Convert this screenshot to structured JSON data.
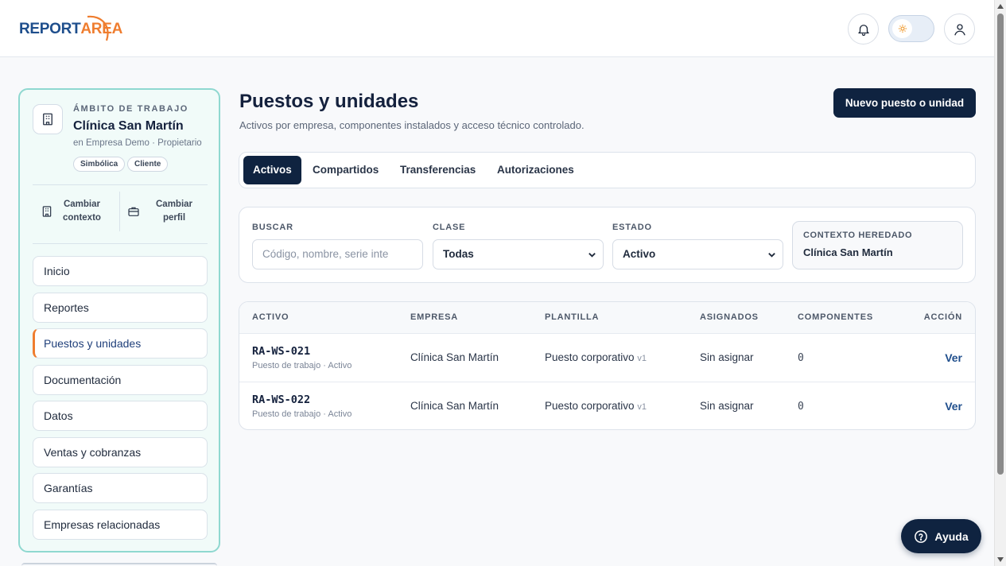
{
  "header": {
    "logo_part1": "REPORT",
    "logo_part2": "AREA",
    "notifications_icon": "bell-icon",
    "theme_icon": "sun-icon",
    "profile_icon": "user-icon"
  },
  "sidebar": {
    "workspace": {
      "kicker": "ÁMBITO DE TRABAJO",
      "name": "Clínica San Martín",
      "subtitle": "en Empresa Demo · Propietario",
      "chips": [
        "Simbólica",
        "Cliente"
      ]
    },
    "change_context": "Cambiar\ncontexto",
    "change_profile": "Cambiar\nperfil",
    "items": [
      {
        "label": "Inicio"
      },
      {
        "label": "Reportes"
      },
      {
        "label": "Puestos y unidades",
        "active": true
      },
      {
        "label": "Documentación"
      },
      {
        "label": "Datos"
      },
      {
        "label": "Ventas y cobranzas"
      },
      {
        "label": "Garantías"
      },
      {
        "label": "Empresas relacionadas"
      }
    ]
  },
  "main": {
    "title": "Puestos y unidades",
    "subtitle": "Activos por empresa, componentes instalados y acceso técnico controlado.",
    "new_button": "Nuevo puesto o unidad",
    "tabs": [
      {
        "label": "Activos",
        "active": true
      },
      {
        "label": "Compartidos"
      },
      {
        "label": "Transferencias"
      },
      {
        "label": "Autorizaciones"
      }
    ],
    "filters": {
      "search_label": "BUSCAR",
      "search_placeholder": "Código, nombre, serie inte",
      "class_label": "CLASE",
      "class_value": "Todas",
      "status_label": "ESTADO",
      "status_value": "Activo",
      "inherited_label": "CONTEXTO HEREDADO",
      "inherited_value": "Clínica San Martín"
    },
    "table": {
      "columns": [
        "ACTIVO",
        "EMPRESA",
        "PLANTILLA",
        "ASIGNADOS",
        "COMPONENTES",
        "ACCIÓN"
      ],
      "rows": [
        {
          "code": "RA-WS-021",
          "meta": "Puesto de trabajo · Activo",
          "company": "Clínica San Martín",
          "template": "Puesto corporativo",
          "version": "v1",
          "assigned": "Sin asignar",
          "components": "0",
          "action": "Ver"
        },
        {
          "code": "RA-WS-022",
          "meta": "Puesto de trabajo · Activo",
          "company": "Clínica San Martín",
          "template": "Puesto corporativo",
          "version": "v1",
          "assigned": "Sin asignar",
          "components": "0",
          "action": "Ver"
        }
      ]
    }
  },
  "help": {
    "label": "Ayuda",
    "icon": "question-circle-icon"
  }
}
